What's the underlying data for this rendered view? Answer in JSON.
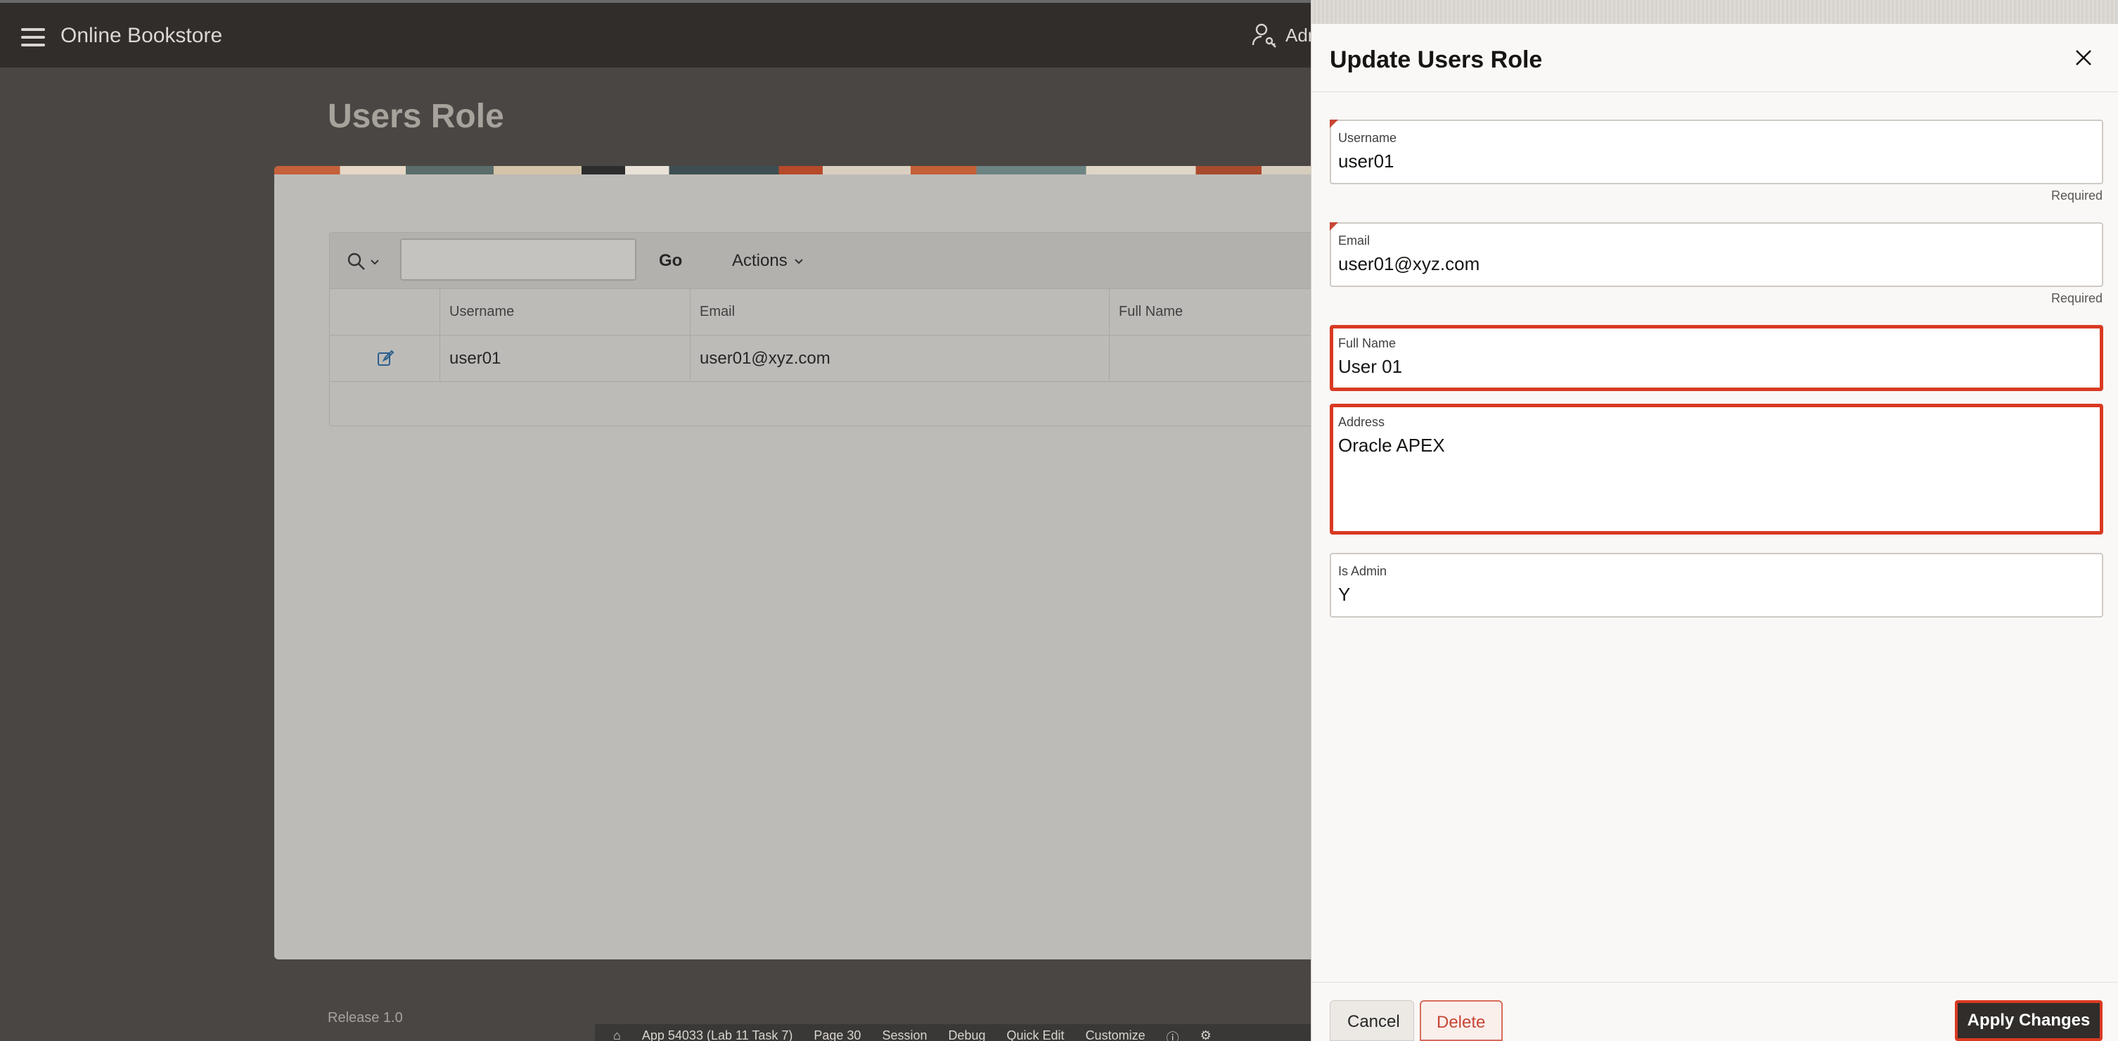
{
  "header": {
    "app_title": "Online Bookstore",
    "user_label": "Adm",
    "menu_icon": "hamburger-icon",
    "user_icon": "user-key-icon"
  },
  "page": {
    "title": "Users Role",
    "release": "Release 1.0"
  },
  "grid": {
    "go_label": "Go",
    "actions_label": "Actions",
    "search_placeholder": "",
    "columns": [
      "Username",
      "Email",
      "Full Name"
    ],
    "rows": [
      {
        "username": "user01",
        "email": "user01@xyz.com",
        "full_name": ""
      }
    ]
  },
  "dev_toolbar": {
    "items": [
      "App 54033 (Lab 11 Task 7)",
      "Page 30",
      "Session",
      "Debug",
      "Quick Edit",
      "Customize"
    ]
  },
  "dialog": {
    "title": "Update Users Role",
    "fields": {
      "username": {
        "label": "Username",
        "value": "user01",
        "note": "Required"
      },
      "email": {
        "label": "Email",
        "value": "user01@xyz.com",
        "note": "Required"
      },
      "full_name": {
        "label": "Full Name",
        "value": "User 01"
      },
      "address": {
        "label": "Address",
        "value": "Oracle APEX"
      },
      "is_admin": {
        "label": "Is Admin",
        "value": "Y"
      }
    },
    "buttons": {
      "cancel": "Cancel",
      "delete": "Delete",
      "apply": "Apply Changes"
    }
  },
  "colors": {
    "header_bg": "#302d2b",
    "highlight_border": "#d93a22",
    "apply_bg": "#312d2a",
    "delete_text": "#c74634"
  }
}
